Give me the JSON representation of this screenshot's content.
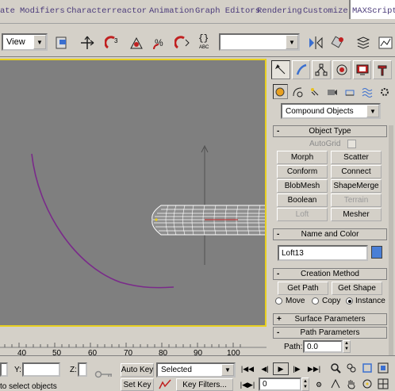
{
  "menubar": {
    "items": [
      "ate",
      "Modifiers",
      "Character",
      "reactor",
      "Animation",
      "Graph Editors",
      "Rendering",
      "Customize",
      "MAXScript"
    ]
  },
  "toolbar": {
    "view_dropdown": "View",
    "selection_set_dropdown": "",
    "icons": [
      "select-and-move-icon",
      "angle-snap-icon",
      "percent-snap-icon",
      "spinner-snap-icon",
      "named-selection-icon",
      "mirror-icon",
      "align-icon",
      "layer-manager-icon"
    ],
    "abc_label": "ABC"
  },
  "command_panel": {
    "tabs": [
      "create-tab",
      "modify-tab",
      "hierarchy-tab",
      "motion-tab",
      "display-tab",
      "utilities-tab"
    ],
    "category_dropdown": "Compound Objects",
    "object_type": {
      "title": "Object Type",
      "pm": "-",
      "autogrid_label": "AutoGrid",
      "buttons": [
        "Morph",
        "Scatter",
        "Conform",
        "Connect",
        "BlobMesh",
        "ShapeMerge",
        "Boolean",
        "Terrain",
        "Loft",
        "Mesher"
      ],
      "disabled": [
        "Terrain",
        "Loft"
      ]
    },
    "name_and_color": {
      "title": "Name and Color",
      "pm": "-",
      "name_value": "Loft13",
      "color": "#4a7fd6"
    },
    "creation_method": {
      "title": "Creation Method",
      "pm": "-",
      "get_path": "Get Path",
      "get_shape": "Get Shape",
      "radios": [
        "Move",
        "Copy",
        "Instance"
      ],
      "selected": "Instance"
    },
    "surface_parameters": {
      "title": "Surface Parameters",
      "pm": "+"
    },
    "path_parameters": {
      "title": "Path Parameters",
      "pm": "-",
      "path_label": "Path:",
      "path_value": "0.0"
    }
  },
  "timeline": {
    "ticks": [
      "40",
      "50",
      "60",
      "70",
      "80",
      "90",
      "100"
    ]
  },
  "statusbar": {
    "y_label": "Y:",
    "z_label": "Z:",
    "auto_key": "Auto Key",
    "set_key": "Set Key",
    "selected_dropdown": "Selected",
    "key_filters": "Key Filters...",
    "frame_value": "0",
    "prompt": "to select objects"
  },
  "colors": {
    "viewport_bg": "#7f7f7f",
    "viewport_border": "#e8d020",
    "spline": "#7a2a8a",
    "mesh": "#ffffff"
  }
}
